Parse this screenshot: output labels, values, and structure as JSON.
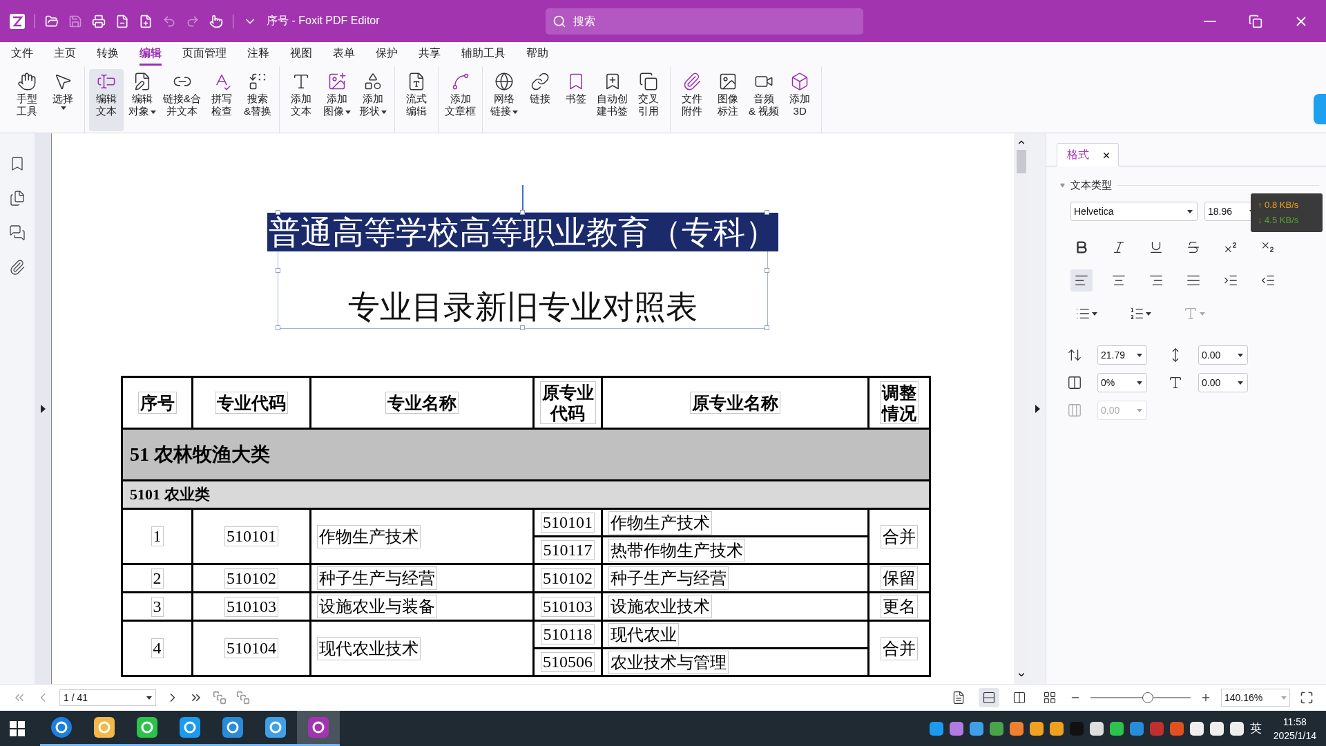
{
  "window": {
    "title": "序号 - Foxit PDF Editor"
  },
  "search": {
    "placeholder": "搜索"
  },
  "menu": [
    {
      "label": "文件",
      "selected": false
    },
    {
      "label": "主页",
      "selected": false
    },
    {
      "label": "转换",
      "selected": false
    },
    {
      "label": "编辑",
      "selected": true
    },
    {
      "label": "页面管理",
      "selected": false
    },
    {
      "label": "注释",
      "selected": false
    },
    {
      "label": "视图",
      "selected": false
    },
    {
      "label": "表单",
      "selected": false
    },
    {
      "label": "保护",
      "selected": false
    },
    {
      "label": "共享",
      "selected": false
    },
    {
      "label": "辅助工具",
      "selected": false
    },
    {
      "label": "帮助",
      "selected": false
    }
  ],
  "ribbon": [
    [
      {
        "lines": [
          "手型",
          "工具"
        ],
        "dropdown": false,
        "selected": false
      },
      {
        "lines": [
          "选择"
        ],
        "dropdown": true,
        "selected": false
      }
    ],
    [
      {
        "lines": [
          "编辑",
          "文本"
        ],
        "dropdown": false,
        "selected": true
      },
      {
        "lines": [
          "编辑",
          "对象"
        ],
        "dropdown": true,
        "selected": false
      },
      {
        "lines": [
          "链接&合",
          "并文本"
        ],
        "dropdown": false,
        "selected": false
      },
      {
        "lines": [
          "拼写",
          "检查"
        ],
        "dropdown": false,
        "selected": false
      },
      {
        "lines": [
          "搜索",
          "&替换"
        ],
        "dropdown": false,
        "selected": false
      }
    ],
    [
      {
        "lines": [
          "添加",
          "文本"
        ],
        "dropdown": false,
        "selected": false
      },
      {
        "lines": [
          "添加",
          "图像"
        ],
        "dropdown": true,
        "selected": false
      },
      {
        "lines": [
          "添加",
          "形状"
        ],
        "dropdown": true,
        "selected": false
      }
    ],
    [
      {
        "lines": [
          "流式",
          "编辑"
        ],
        "dropdown": false,
        "selected": false
      }
    ],
    [
      {
        "lines": [
          "添加",
          "文章框"
        ],
        "dropdown": false,
        "selected": false
      }
    ],
    [
      {
        "lines": [
          "网络",
          "链接"
        ],
        "dropdown": true,
        "selected": false
      },
      {
        "lines": [
          "链接"
        ],
        "dropdown": false,
        "selected": false
      },
      {
        "lines": [
          "书签"
        ],
        "dropdown": false,
        "selected": false
      },
      {
        "lines": [
          "自动创",
          "建书签"
        ],
        "dropdown": false,
        "selected": false
      },
      {
        "lines": [
          "交叉",
          "引用"
        ],
        "dropdown": false,
        "selected": false
      }
    ],
    [
      {
        "lines": [
          "文件",
          "附件"
        ],
        "dropdown": false,
        "selected": false
      },
      {
        "lines": [
          "图像",
          "标注"
        ],
        "dropdown": false,
        "selected": false
      },
      {
        "lines": [
          "音频",
          "& 视频"
        ],
        "dropdown": false,
        "selected": false
      },
      {
        "lines": [
          "添加",
          "3D"
        ],
        "dropdown": false,
        "selected": false
      }
    ]
  ],
  "document": {
    "heading": [
      {
        "text": "普通高等学校高等职业教育（专科）",
        "selected": true
      },
      {
        "text": "专业目录新旧专业对照表",
        "selected": false
      }
    ],
    "table": {
      "columns": [
        [
          "序号"
        ],
        [
          "专业代码"
        ],
        [
          "专业名称"
        ],
        [
          "原专业",
          "代码"
        ],
        [
          "原专业名称"
        ],
        [
          "调整",
          "情况"
        ]
      ],
      "category": "51 农林牧渔大类",
      "subcategory": "5101 农业类",
      "rows": [
        {
          "seq": "1",
          "code": "510101",
          "name": "作物生产技术",
          "status": "合并",
          "originals": [
            {
              "code": "510101",
              "name": "作物生产技术"
            },
            {
              "code": "510117",
              "name": "热带作物生产技术"
            }
          ]
        },
        {
          "seq": "2",
          "code": "510102",
          "name": "种子生产与经营",
          "status": "保留",
          "originals": [
            {
              "code": "510102",
              "name": "种子生产与经营"
            }
          ]
        },
        {
          "seq": "3",
          "code": "510103",
          "name": "设施农业与装备",
          "status": "更名",
          "originals": [
            {
              "code": "510103",
              "name": "设施农业技术"
            }
          ]
        },
        {
          "seq": "4",
          "code": "510104",
          "name": "现代农业技术",
          "status": "合并",
          "originals": [
            {
              "code": "510118",
              "name": "现代农业"
            },
            {
              "code": "510506",
              "name": "农业技术与管理"
            }
          ]
        }
      ]
    }
  },
  "format_panel": {
    "tab": "格式",
    "section": "文本类型",
    "font": "Helvetica",
    "size": "18.96",
    "align_buttons": [
      {
        "selected": true
      },
      {
        "selected": false
      },
      {
        "selected": false
      },
      {
        "selected": false
      },
      {
        "selected": false
      },
      {
        "selected": false
      }
    ],
    "spacing_fields": [
      {
        "value": "21.79",
        "disabled": false
      },
      {
        "value": "0.00",
        "disabled": false
      },
      {
        "value": "0%",
        "disabled": false
      },
      {
        "value": "0.00",
        "disabled": false
      },
      {
        "value": "0.00",
        "disabled": true
      }
    ]
  },
  "network": {
    "up": "↑ 0.8 KB/s",
    "down": "↓ 4.5 KB/s"
  },
  "status_bar": {
    "page": "1 / 41",
    "zoom": "140.16%",
    "view_buttons": [
      {
        "selected": false
      },
      {
        "selected": true
      },
      {
        "selected": false
      },
      {
        "selected": false
      }
    ],
    "zoom_slider": {
      "level": 0.57
    }
  },
  "taskbar": {
    "apps": [
      {
        "selected": false
      },
      {
        "selected": false
      },
      {
        "selected": false
      },
      {
        "selected": false
      },
      {
        "selected": false
      },
      {
        "selected": false
      },
      {
        "selected": true
      }
    ],
    "ime": "英",
    "time": "11:58",
    "date": "2025/1/14"
  }
}
